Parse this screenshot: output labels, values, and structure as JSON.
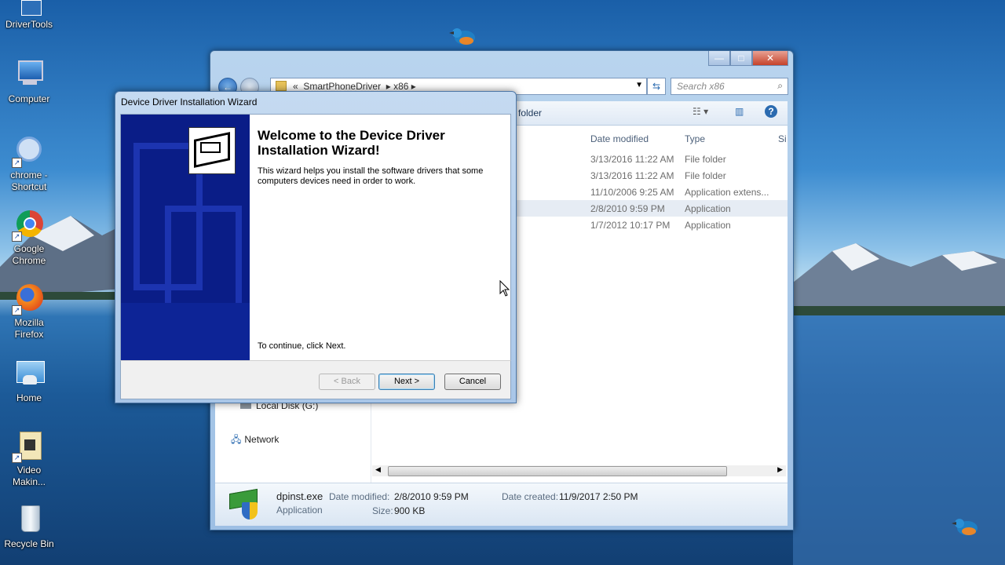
{
  "desktop": {
    "icons": [
      {
        "label": "DriverTools"
      },
      {
        "label": "Computer"
      },
      {
        "label": "chrome - Shortcut"
      },
      {
        "label": "Google Chrome"
      },
      {
        "label": "Mozilla Firefox"
      },
      {
        "label": "Home"
      },
      {
        "label": "Video Makin..."
      },
      {
        "label": "Recycle Bin"
      }
    ]
  },
  "explorer": {
    "breadcrumb": [
      "«",
      "SmartPhoneDriver",
      "x86"
    ],
    "search_placeholder": "Search x86",
    "toolbar_partial_label": "folder",
    "columns": {
      "date": "Date modified",
      "type": "Type",
      "size": "Si"
    },
    "rows": [
      {
        "date": "3/13/2016 11:22 AM",
        "type": "File folder"
      },
      {
        "date": "3/13/2016 11:22 AM",
        "type": "File folder"
      },
      {
        "date": "11/10/2006 9:25 AM",
        "type": "Application extens..."
      },
      {
        "date": "2/8/2010 9:59 PM",
        "type": "Application"
      },
      {
        "date": "1/7/2012 10:17 PM",
        "type": "Application"
      }
    ],
    "nav": {
      "local_disk": "Local Disk (G:)",
      "network": "Network"
    },
    "details": {
      "filename": "dpinst.exe",
      "filetype": "Application",
      "modified_label": "Date modified:",
      "modified_value": "2/8/2010 9:59 PM",
      "created_label": "Date created:",
      "created_value": "11/9/2017 2:50 PM",
      "size_label": "Size:",
      "size_value": "900 KB"
    },
    "controls": {
      "minimize": "—",
      "maximize": "□",
      "close": "✕"
    }
  },
  "wizard": {
    "title": "Device Driver Installation Wizard",
    "heading": "Welcome to the Device Driver Installation Wizard!",
    "description": "This wizard helps you install the software drivers that some computers devices need in order to work.",
    "continue_text": "To continue, click Next.",
    "buttons": {
      "back": "< Back",
      "next": "Next >",
      "cancel": "Cancel"
    }
  }
}
